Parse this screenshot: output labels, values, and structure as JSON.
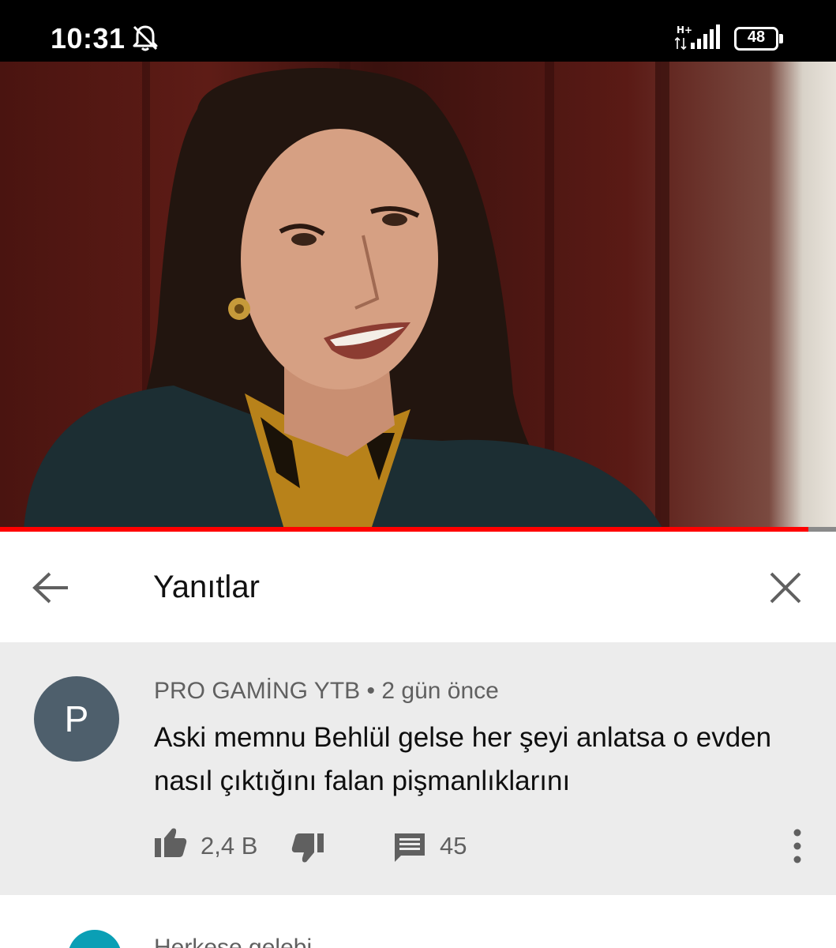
{
  "status_bar": {
    "time": "10:31",
    "network": "H+",
    "battery": "48"
  },
  "video": {
    "progress": 0.967
  },
  "replies": {
    "title": "Yanıtlar"
  },
  "comment": {
    "avatar_letter": "P",
    "author": "PRO GAMİNG YTB",
    "separator": "•",
    "time": "2 gün önce",
    "text": "Aski memnu Behlül gelse her şeyi anlatsa o evden nasıl çıktığını falan pişmanlıklarını",
    "likes": "2,4 B",
    "replies": "45"
  },
  "next_comment": {
    "meta": "Herkese gelebi ..."
  },
  "icons": {
    "back": "arrow-left-icon",
    "close": "close-icon",
    "like": "thumb-up-icon",
    "dislike": "thumb-down-icon",
    "reply": "comment-icon",
    "more": "more-vertical-icon",
    "bell": "bell-off-icon"
  },
  "colors": {
    "progress": "#ff0000",
    "avatar": "#4e5f6c",
    "comment_bg": "#ececec"
  }
}
